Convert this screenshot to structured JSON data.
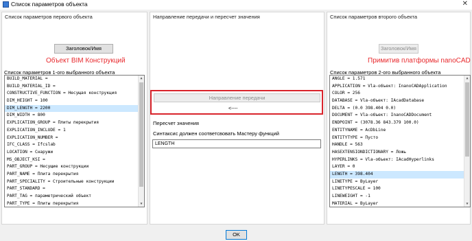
{
  "window": {
    "title": "Список параметров объекта",
    "close_glyph": "✕"
  },
  "left_panel": {
    "caption": "Список параметров первого объекта",
    "header_button": "Заголовок/Имя",
    "red_caption": "Объект BIM Конструкций",
    "list_caption": "Список параметров 1-ого выбранного объекта",
    "items": [
      "BUILD_MATERIAL =",
      "BUILD_MATERIAL_ID =",
      "CONSTRUCTIVE_FUNCTION = Несущая конструкция",
      "DIM_HEIGHT = 100",
      "DIM_LENGTH = 2200",
      "DIM_WIDTH = 800",
      "EXPLICATION_GROUP = Плиты перекрытия",
      "EXPLICATION_INCLUDE = 1",
      "EXPLICATION_NUMBER =",
      "IFC_CLASS = Ifcslab",
      "LOCATION = Снаружи",
      "MS_OBJECT_KSI =",
      "PART_GROUP = Несущие конструкции",
      "PART_NAME = Плита перекрытия",
      "PART_SPECIALITY = Строительные конструкции",
      "PART_STANDARD =",
      "PART_TAG = параметрический объект",
      "PART_TYPE = Плиты перекрытия"
    ],
    "selected_index": 4
  },
  "middle_panel": {
    "caption": "Направление передачи и пересчет значения",
    "transfer_button": "Направление передачи",
    "arrow_text": "<----",
    "recalc_label": "Пересчет значения",
    "syntax_label": "Синтаксис должен соответсвовать Мастеру функций",
    "formula_value": "LENGTH"
  },
  "right_panel": {
    "caption": "Список параметров второго объекта",
    "header_button": "Заголовок/Имя",
    "red_caption": "Примитив платформы nanoCAD",
    "list_caption": "Список параметров 2-ого выбранного объекта",
    "items": [
      "ANGLE = 1.571",
      "APPLICATION = Vla-объект: InanoCADApplication",
      "COLOR = 256",
      "DATABASE = Vla-объект: IAcadDatabase",
      "DELTA = (0.0 398.404 0.0)",
      "DOCUMENT = Vla-объект: InanoCADDocument",
      "ENDPOINT = (3078.36 843.379 100.0)",
      "ENTITYNAME = AcDbLine",
      "ENTITYTYPE = Пусто",
      "HANDLE = 563",
      "HASEXTENSIONDICTIONARY = Ложь",
      "HYPERLINKS = Vla-объект: IAcadHyperlinks",
      "LAYER = 0",
      "LENGTH = 398.404",
      "LINETYPE = ByLayer",
      "LINETYPESCALE = 100",
      "LINEWEIGHT = -1",
      "MATERIAL = ByLayer"
    ],
    "selected_index": 13
  },
  "footer": {
    "ok_button": "OK"
  },
  "icons": {
    "scroll_up": "▲",
    "scroll_down": "▼"
  }
}
